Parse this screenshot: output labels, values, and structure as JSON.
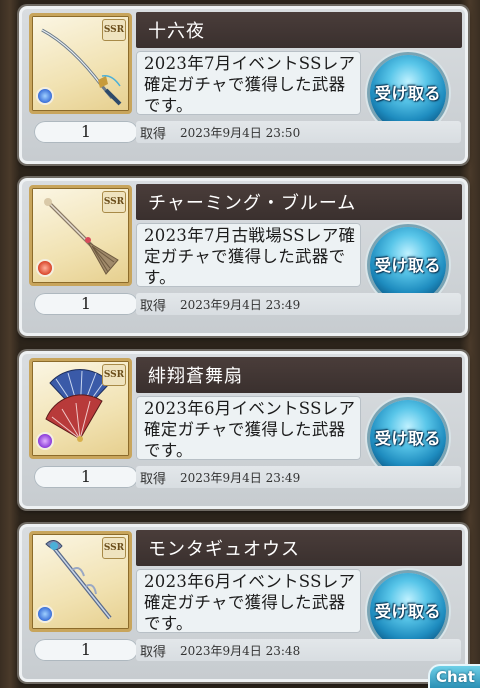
{
  "items": [
    {
      "name": "十六夜",
      "description": "2023年7月イベントSSレア確定ガチャで獲得した武器です。",
      "rarity": "SSR",
      "quantity": "1",
      "acquired_label": "取得",
      "acquired_date": "2023年9月4日 23:50",
      "receive_label": "受け取る",
      "element_color": "#3a6fd8",
      "icon": "katana-icon"
    },
    {
      "name": "チャーミング・ブルーム",
      "description": "2023年7月古戦場SSレア確定ガチャで獲得した武器です。",
      "rarity": "SSR",
      "quantity": "1",
      "acquired_label": "取得",
      "acquired_date": "2023年9月4日 23:49",
      "receive_label": "受け取る",
      "element_color": "#d8452a",
      "icon": "broom-icon"
    },
    {
      "name": "緋翔蒼舞扇",
      "description": "2023年6月イベントSSレア確定ガチャで獲得した武器です。",
      "rarity": "SSR",
      "quantity": "1",
      "acquired_label": "取得",
      "acquired_date": "2023年9月4日 23:49",
      "receive_label": "受け取る",
      "element_color": "#8a3ad8",
      "icon": "fan-icon"
    },
    {
      "name": "モンタギュオウス",
      "description": "2023年6月イベントSSレア確定ガチャで獲得した武器です。",
      "rarity": "SSR",
      "quantity": "1",
      "acquired_label": "取得",
      "acquired_date": "2023年9月4日 23:48",
      "receive_label": "受け取る",
      "element_color": "#3a6fd8",
      "icon": "staff-icon"
    }
  ],
  "chat_label": "Chat"
}
